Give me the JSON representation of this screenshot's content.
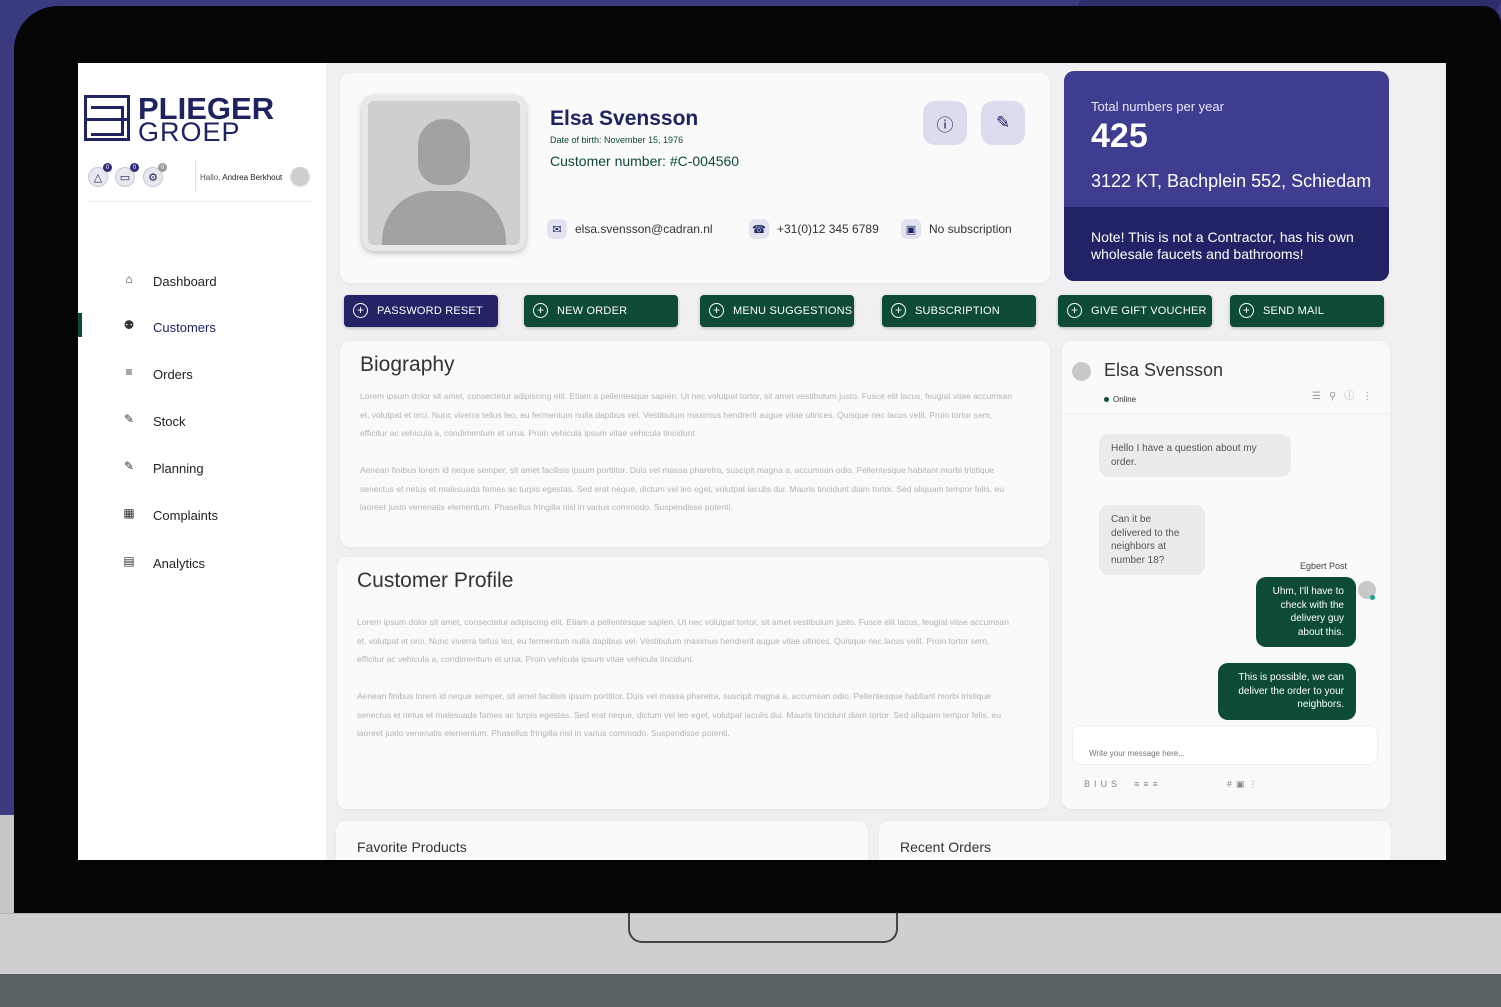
{
  "sidebar": {
    "logo_top": "PLIEGER",
    "logo_bottom": "GROEP",
    "badges": [
      "0",
      "0",
      "0"
    ],
    "hello_prefix": "Hallo,",
    "hello_name": "Andrea Berkhout",
    "nav": [
      {
        "label": "Dashboard",
        "icon": "home-icon"
      },
      {
        "label": "Customers",
        "icon": "user-icon"
      },
      {
        "label": "Orders",
        "icon": "list-icon"
      },
      {
        "label": "Stock",
        "icon": "pencil-icon"
      },
      {
        "label": "Planning",
        "icon": "edit-icon"
      },
      {
        "label": "Complaints",
        "icon": "calendar-icon"
      },
      {
        "label": "Analytics",
        "icon": "bar-chart-icon"
      }
    ],
    "active_item": "Customers"
  },
  "profile": {
    "name": "Elsa Svensson",
    "dob": "Date of birth: November 15, 1976",
    "customer_number": "Customer number: #C-004560",
    "email": "elsa.svensson@cadran.nl",
    "phone": "+31(0)12 345 6789",
    "subscription": "No subscription"
  },
  "totals": {
    "label": "Total numbers per year",
    "value": "425",
    "address": "3122 KT, Bachplein 552, Schiedam",
    "note": "Note! This is not a Contractor, has his own wholesale faucets and bathrooms!"
  },
  "actions": [
    "PASSWORD RESET",
    "NEW ORDER",
    "MENU SUGGESTIONS",
    "SUBSCRIPTION",
    "GIVE GIFT VOUCHER",
    "SEND MAIL"
  ],
  "biography": {
    "title": "Biography",
    "p1": "Lorem ipsum dolor sit amet, consectetur adipiscing elit. Etiam a pellentesque sapien. Ut nec volutpat tortor, sit amet vestibulum justo. Fusce elit lacus, feugiat vitae accumsan et, volutpat et orci. Nunc viverra tellus leo, eu fermentum nulla dapibus vel. Vestibulum maximus hendrerit augue vitae ultrices. Quisque nec lacus velit. Proin tortor sem, efficitur ac vehicula a, condimentum et urna. Proin vehicula ipsum vitae vehicula tincidunt.",
    "p2": "Aenean finibus lorem id neque semper, sit amet facilisis ipsum porttitor. Duis vel massa pharetra, suscipit magna a, accumsan odio. Pellentesque habitant morbi tristique senectus et netus et malesuada fames ac turpis egestas. Sed erat neque, dictum vel leo eget, volutpat iaculis dui. Mauris tincidunt diam tortor. Sed aliquam tempor felis, eu laoreet justo venenatis elementum. Phasellus fringilla nisl in varius commodo. Suspendisse potenti."
  },
  "customer_profile": {
    "title": "Customer Profile",
    "p1": "Lorem ipsum dolor sit amet, consectetur adipiscing elit. Etiam a pellentesque sapien. Ut nec volutpat tortor, sit amet vestibulum justo. Fusce elit lacus, feugiat vitae accumsan et, volutpat et orci. Nunc viverra tellus leo, eu fermentum nulla dapibus vel. Vestibulum maximus hendrerit augue vitae ultrices. Quisque nec lacus velit. Proin tortor sem, efficitur ac vehicula a, condimentum et urna. Proin vehicula ipsum vitae vehicula tincidunt.",
    "p2": "Aenean finibus lorem id neque semper, sit amet facilisis ipsum porttitor. Duis vel massa pharetra, suscipit magna a, accumsan odio. Pellentesque habitant morbi tristique senectus et netus et malesuada fames ac turpis egestas. Sed erat neque, dictum vel leo eget, volutpat iaculis dui. Mauris tincidunt diam tortor. Sed aliquam tempor felis, eu laoreet justo venenatis elementum. Phasellus fringilla nisl in varius commodo. Suspendisse potenti."
  },
  "chat": {
    "name": "Elsa Svensson",
    "status": "Online",
    "messages": [
      {
        "from": "customer",
        "text": "Hello I have a question about my order."
      },
      {
        "from": "customer",
        "text": "Can it be delivered to the neighbors at number 18?"
      },
      {
        "from": "agent",
        "text": "Uhm, I'll have to check with the delivery guy about this."
      },
      {
        "from": "agent",
        "text": "This is possible, we can deliver the order to your neighbors."
      }
    ],
    "agent_name": "Egbert Post",
    "input_placeholder": "Write your message here..."
  },
  "favorite_products": {
    "title": "Favorite Products"
  },
  "recent_orders": {
    "title": "Recent Orders"
  },
  "colors": {
    "brand_navy": "#1e2460",
    "accent_purple": "#3e3d8f",
    "accent_green": "#0d4a37"
  }
}
